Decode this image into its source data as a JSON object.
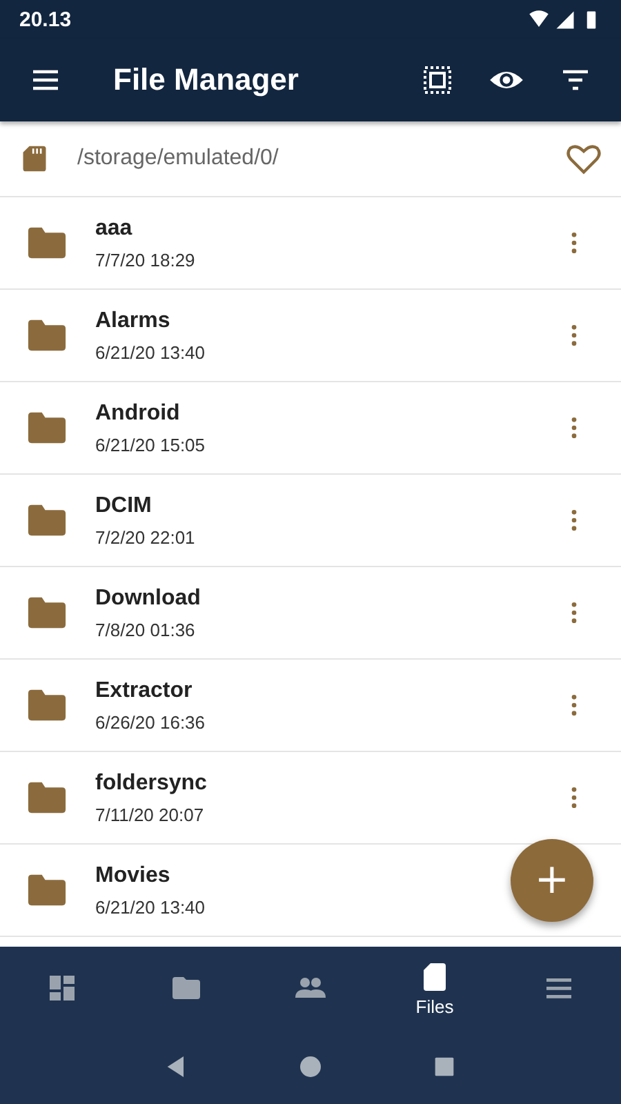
{
  "status_bar": {
    "time": "20.13"
  },
  "app_bar": {
    "title": "File Manager"
  },
  "path_bar": {
    "path": "/storage/emulated/0/",
    "favorite": false
  },
  "files": [
    {
      "name": "aaa",
      "date": "7/7/20 18:29"
    },
    {
      "name": "Alarms",
      "date": "6/21/20 13:40"
    },
    {
      "name": "Android",
      "date": "6/21/20 15:05"
    },
    {
      "name": "DCIM",
      "date": "7/2/20 22:01"
    },
    {
      "name": "Download",
      "date": "7/8/20 01:36"
    },
    {
      "name": "Extractor",
      "date": "6/26/20 16:36"
    },
    {
      "name": "foldersync",
      "date": "7/11/20 20:07"
    },
    {
      "name": "Movies",
      "date": "6/21/20 13:40",
      "menu_hidden": true
    }
  ],
  "fab": {
    "label": "+"
  },
  "bottom_nav": [
    {
      "kind": "dashboard",
      "selected": false
    },
    {
      "kind": "folder",
      "selected": false
    },
    {
      "kind": "people",
      "selected": false
    },
    {
      "kind": "sdcard",
      "selected": true,
      "label": "Files"
    },
    {
      "kind": "menu",
      "selected": false
    }
  ]
}
